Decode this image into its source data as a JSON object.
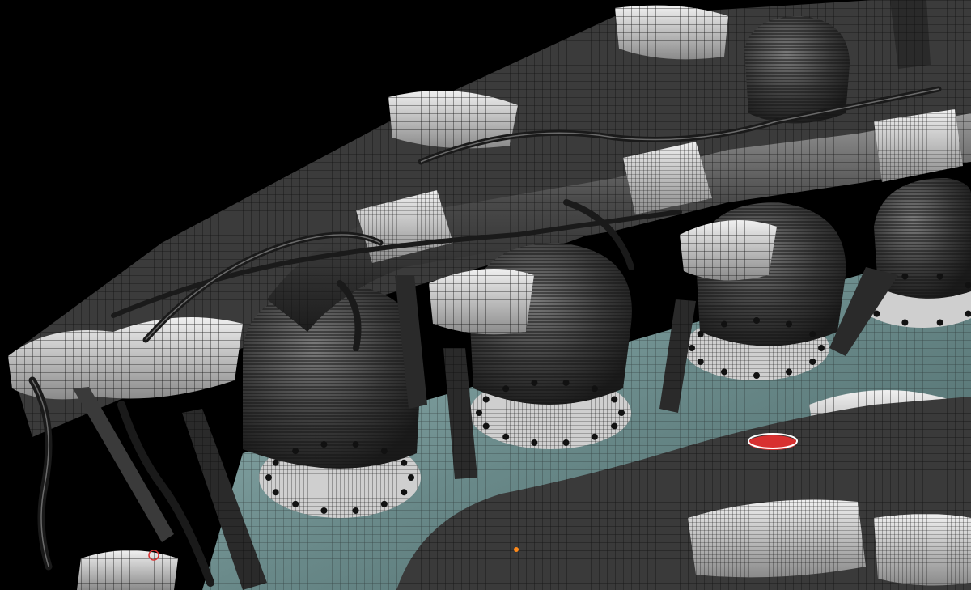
{
  "scene": {
    "subject": "wireframe-engine-model",
    "colors": {
      "background": "#000000",
      "block": "#5d7a7a",
      "block_light": "#8fb0b0",
      "metal_dark": "#2a2a2a",
      "metal_mid": "#5a5a5a",
      "metal_light": "#cfcfcf",
      "wire": "#111111",
      "accent_red": "#d83030",
      "accent_orange": "#ff8a1a"
    }
  }
}
